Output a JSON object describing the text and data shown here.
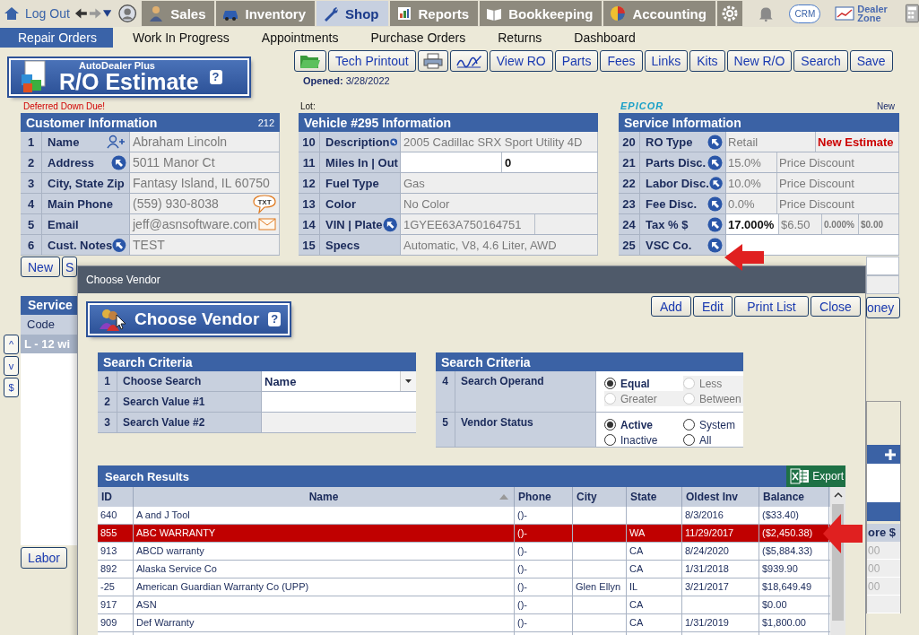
{
  "top_nav": {
    "logout": "Log Out",
    "tabs": [
      {
        "label": "Sales",
        "kind": "person",
        "selected": false
      },
      {
        "label": "Inventory",
        "kind": "car",
        "selected": false
      },
      {
        "label": "Shop",
        "kind": "wrench",
        "selected": true
      },
      {
        "label": "Reports",
        "kind": "report",
        "selected": false
      },
      {
        "label": "Bookkeeping",
        "kind": "book",
        "selected": false
      },
      {
        "label": "Accounting",
        "kind": "pie",
        "selected": false
      }
    ],
    "crm": "CRM",
    "dealer_zone": "Dealer Zone"
  },
  "sub_nav": [
    {
      "label": "Repair Orders",
      "selected": true
    },
    {
      "label": "Work In Progress",
      "selected": false
    },
    {
      "label": "Appointments",
      "selected": false
    },
    {
      "label": "Purchase Orders",
      "selected": false
    },
    {
      "label": "Returns",
      "selected": false
    },
    {
      "label": "Dashboard",
      "selected": false
    }
  ],
  "header": {
    "brand": "AutoDealer Plus",
    "title": "R/O Estimate",
    "help": "?",
    "opened": "**Opened:** 3/28/2022",
    "toolbar": [
      {
        "kind": "folder"
      },
      {
        "kind": "text",
        "label": "Tech Printout"
      },
      {
        "kind": "printer"
      },
      {
        "kind": "signature"
      },
      {
        "kind": "text",
        "label": "View RO"
      },
      {
        "kind": "text",
        "label": "Parts"
      },
      {
        "kind": "text",
        "label": "Fees"
      },
      {
        "kind": "text",
        "label": "Links"
      },
      {
        "kind": "text",
        "label": "Kits"
      },
      {
        "kind": "text",
        "label": "New R/O"
      },
      {
        "kind": "text",
        "label": "Search"
      },
      {
        "kind": "text",
        "label": "Save"
      }
    ]
  },
  "notices": {
    "alert": "Deferred Down Due!",
    "lot": "Lot:",
    "vendor_logo": "EPICOR",
    "status": "New"
  },
  "panels": [
    {
      "title": "Customer Information",
      "count": "212",
      "rows": [
        {
          "num": "1",
          "label": "Name",
          "kind": "contact",
          "cells": [
            {
              "text": "Abraham Lincoln",
              "kind": "readonly"
            }
          ]
        },
        {
          "num": "2",
          "label": "Address",
          "kind": "lookup",
          "cells": [
            {
              "text": "5011 Manor Ct",
              "kind": "readonly"
            }
          ]
        },
        {
          "num": "3",
          "label": "City, State Zip",
          "kind": "plain",
          "cells": [
            {
              "text": "Fantasy Island, IL 60750",
              "kind": "readonly"
            }
          ]
        },
        {
          "num": "4",
          "label": "Main Phone",
          "kind": "phone",
          "badge": "TXT",
          "cells": [
            {
              "text": "(559) 930-8038",
              "kind": "readonly"
            }
          ]
        },
        {
          "num": "5",
          "label": "Email",
          "kind": "email",
          "cells": [
            {
              "text": "jeff@asnsoftware.com",
              "kind": "readonly"
            }
          ]
        },
        {
          "num": "6",
          "label": "Cust. Notes",
          "kind": "lookup",
          "cells": [
            {
              "text": "TEST",
              "kind": "readonly"
            }
          ]
        }
      ]
    },
    {
      "title": "Vehicle #295 Information",
      "rows": [
        {
          "num": "10",
          "label": "Description",
          "kind": "lookup",
          "cells": [
            {
              "text": "2005 Cadillac SRX Sport Utility 4D",
              "kind": "readonly"
            }
          ]
        },
        {
          "num": "11",
          "label": "Miles In | Out",
          "kind": "plain",
          "cells": [
            {
              "kind": "input"
            },
            {
              "text": "0",
              "kind": "input"
            }
          ]
        },
        {
          "num": "12",
          "label": "Fuel Type",
          "kind": "plain",
          "cells": [
            {
              "text": "Gas",
              "kind": "readonly"
            }
          ]
        },
        {
          "num": "13",
          "label": "Color",
          "kind": "plain",
          "cells": [
            {
              "text": "No Color",
              "kind": "readonly"
            }
          ]
        },
        {
          "num": "14",
          "label": "VIN | Plate",
          "kind": "lookup",
          "cells": [
            {
              "text": "1GYEE63A750164751",
              "kind": "readonly"
            },
            {
              "kind": "readonly"
            }
          ]
        },
        {
          "num": "15",
          "label": "Specs",
          "kind": "plain",
          "cells": [
            {
              "text": "Automatic, V8, 4.6 Liter, AWD",
              "kind": "readonly"
            }
          ]
        }
      ]
    },
    {
      "title": "Service Information",
      "rows": [
        {
          "num": "20",
          "label": "RO Type",
          "kind": "lookup",
          "cells": [
            {
              "text": "Retail",
              "kind": "readonly"
            },
            {
              "text": "New Estimate",
              "kind": "alert"
            }
          ]
        },
        {
          "num": "21",
          "label": "Parts Disc.",
          "kind": "lookup",
          "cells": [
            {
              "text": "15.0%",
              "kind": "readonly"
            },
            {
              "text": "Price Discount",
              "kind": "readonly"
            }
          ]
        },
        {
          "num": "22",
          "label": "Labor Disc.",
          "kind": "lookup",
          "cells": [
            {
              "text": "10.0%",
              "kind": "readonly"
            },
            {
              "text": "Price Discount",
              "kind": "readonly"
            }
          ]
        },
        {
          "num": "23",
          "label": "Fee Disc.",
          "kind": "lookup",
          "cells": [
            {
              "text": "0.0%",
              "kind": "readonly"
            },
            {
              "text": "Price Discount",
              "kind": "readonly"
            }
          ]
        },
        {
          "num": "24",
          "label": "Tax % $",
          "kind": "lookup",
          "cells": [
            {
              "text": "17.000%",
              "kind": "input"
            },
            {
              "text": "$6.50",
              "kind": "readonly"
            },
            {
              "text": "0.000%",
              "kind": "small"
            },
            {
              "text": "$0.00",
              "kind": "small"
            }
          ]
        },
        {
          "num": "25",
          "label": "VSC Co.",
          "kind": "lookup",
          "cells": [
            {
              "kind": "input"
            }
          ]
        }
      ]
    }
  ],
  "background_left": {
    "buttons": [
      "New",
      "S"
    ],
    "panel_title": "Service",
    "column": "Code",
    "row": {
      "text": "L - 12 wi",
      "selected": true
    },
    "nav_buttons": [
      "^",
      "v",
      "$"
    ],
    "bottom_button": "Labor"
  },
  "background_right": {
    "button": "oney",
    "column": "ore $",
    "cells": [
      "00",
      "00",
      "00"
    ]
  },
  "modal": {
    "title": "Choose Vendor",
    "heading": "Choose Vendor",
    "help": "?",
    "buttons": [
      "Add",
      "Edit",
      "Print List",
      "Close"
    ],
    "criteria": [
      {
        "title": "Search Criteria",
        "rows": [
          {
            "num": "1",
            "label": "Choose Search",
            "kind": "select",
            "value": "Name"
          },
          {
            "num": "2",
            "label": "Search Value #1",
            "kind": "input"
          },
          {
            "num": "3",
            "label": "Search Value #2",
            "kind": "disabled"
          }
        ]
      },
      {
        "title": "Search Criteria",
        "rows": [
          {
            "num": "4",
            "label": "Search Operand",
            "kind": "radio",
            "options": [
              {
                "label": "Equal",
                "checked": true,
                "disabled": false
              },
              {
                "label": "Less",
                "checked": false,
                "disabled": true
              },
              {
                "label": "Greater",
                "checked": false,
                "disabled": true
              },
              {
                "label": "Between",
                "checked": false,
                "disabled": true
              }
            ]
          },
          {
            "num": "5",
            "label": "Vendor Status",
            "kind": "radio",
            "options": [
              {
                "label": "Active",
                "checked": true,
                "disabled": false
              },
              {
                "label": "System",
                "checked": false,
                "disabled": false
              },
              {
                "label": "Inactive",
                "checked": false,
                "disabled": false
              },
              {
                "label": "All",
                "checked": false,
                "disabled": false
              }
            ]
          }
        ]
      }
    ],
    "results": {
      "title": "Search Results",
      "export": "Export",
      "columns": [
        {
          "label": "ID",
          "sorted": false
        },
        {
          "label": "Name",
          "sorted": true
        },
        {
          "label": "Phone",
          "sorted": false
        },
        {
          "label": "City",
          "sorted": false
        },
        {
          "label": "State",
          "sorted": false
        },
        {
          "label": "Oldest Inv",
          "sorted": false
        },
        {
          "label": "Balance",
          "sorted": false
        }
      ],
      "rows": [
        {
          "selected": false,
          "cells": [
            "640",
            "A and J Tool",
            "()-",
            "",
            "",
            "8/3/2016",
            "($33.40)"
          ]
        },
        {
          "selected": true,
          "cells": [
            "855",
            "ABC WARRANTY",
            "()-",
            "",
            "WA",
            "11/29/2017",
            "($2,450.38)"
          ]
        },
        {
          "selected": false,
          "cells": [
            "913",
            "ABCD warranty",
            "()-",
            "",
            "CA",
            "8/24/2020",
            "($5,884.33)"
          ]
        },
        {
          "selected": false,
          "cells": [
            "892",
            "Alaska Service Co",
            "()-",
            "",
            "CA",
            "1/31/2018",
            "$939.90"
          ]
        },
        {
          "selected": false,
          "cells": [
            "-25",
            "American Guardian Warranty Co (UPP)",
            "()-",
            "Glen Ellyn",
            "IL",
            "3/21/2017",
            "$18,649.49"
          ]
        },
        {
          "selected": false,
          "cells": [
            "917",
            "ASN",
            "()-",
            "",
            "CA",
            "",
            "$0.00"
          ]
        },
        {
          "selected": false,
          "cells": [
            "909",
            "Def Warranty",
            "()-",
            "",
            "CA",
            "1/31/2019",
            "$1,800.00"
          ]
        }
      ]
    }
  }
}
